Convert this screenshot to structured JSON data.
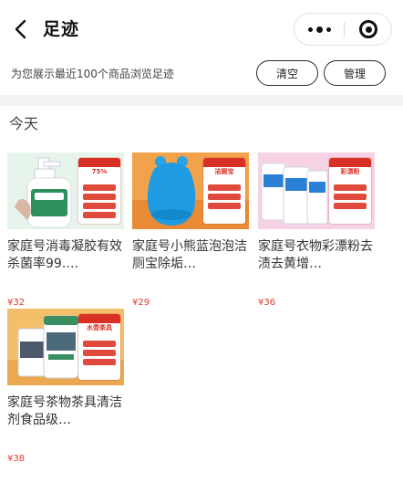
{
  "nav": {
    "title": "足迹"
  },
  "subbar": {
    "info": "为您展示最近100个商品浏览足迹",
    "clear_label": "清空",
    "manage_label": "管理"
  },
  "section": {
    "title": "今天"
  },
  "products": [
    {
      "title": "家庭号消毒凝胶有效杀菌率99.…",
      "price": "¥32",
      "thumb_bg": "#e7f5ec"
    },
    {
      "title": "家庭号小熊蓝泡泡洁厕宝除垢…",
      "price": "¥29",
      "thumb_bg": "#f3a04a"
    },
    {
      "title": "家庭号衣物彩漂粉去渍去黄增…",
      "price": "¥36",
      "thumb_bg": "#f7d2e4"
    },
    {
      "title": "家庭号茶物茶具清洁剂食品级…",
      "price": "¥38",
      "thumb_bg": "#f5c06a"
    }
  ],
  "colors": {
    "price": "#e53a2d",
    "accent_red": "#d93026"
  }
}
